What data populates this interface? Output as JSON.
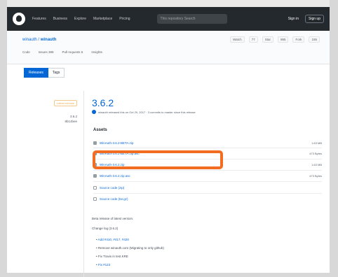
{
  "header": {
    "nav": [
      "Features",
      "Business",
      "Explore",
      "Marketplace",
      "Pricing"
    ],
    "search_placeholder": "This repository   Search",
    "sign_in": "Sign in",
    "sign_up": "Sign up"
  },
  "repo": {
    "owner": "winauth",
    "name": "winauth",
    "actions": [
      "Watch",
      "77",
      "Star",
      "955",
      "Fork",
      "155"
    ],
    "tabs": [
      "Code",
      "Issues 385",
      "Pull requests 5",
      "Insights"
    ]
  },
  "toggle": {
    "releases": "Releases",
    "tags": "Tags"
  },
  "release": {
    "badge": "Latest release",
    "tag": "3.6.2",
    "commit": "8b14bee",
    "version": "3.6.2",
    "byline": "winauth released this on Oct 29, 2017 · 3 commits to master since this release",
    "assets_heading": "Assets",
    "assets": [
      {
        "name": "WinAuth-3.6.2-BETA.zip",
        "size": "1.63 MB"
      },
      {
        "name": "WinAuth-3.6.2-BETA.zip.asc",
        "size": "473 Bytes"
      },
      {
        "name": "WinAuth-3.6.2.zip",
        "size": "1.63 MB"
      },
      {
        "name": "WinAuth-3.6.2.zip.asc",
        "size": "473 Bytes"
      },
      {
        "name": "Source code (zip)",
        "size": ""
      },
      {
        "name": "Source code (tar.gz)",
        "size": ""
      }
    ],
    "description": "Beta release of latest version.",
    "changelog_heading": "Change log (3.6.2)",
    "changes": [
      "Add #410, #417, #420",
      "Remove winauth.com (Migrating to only github)",
      "Fix Travis in test.KRE",
      "Fix #123"
    ]
  },
  "colors": {
    "highlight": "#f26d21",
    "link": "#0366d6",
    "header": "#24292e"
  }
}
